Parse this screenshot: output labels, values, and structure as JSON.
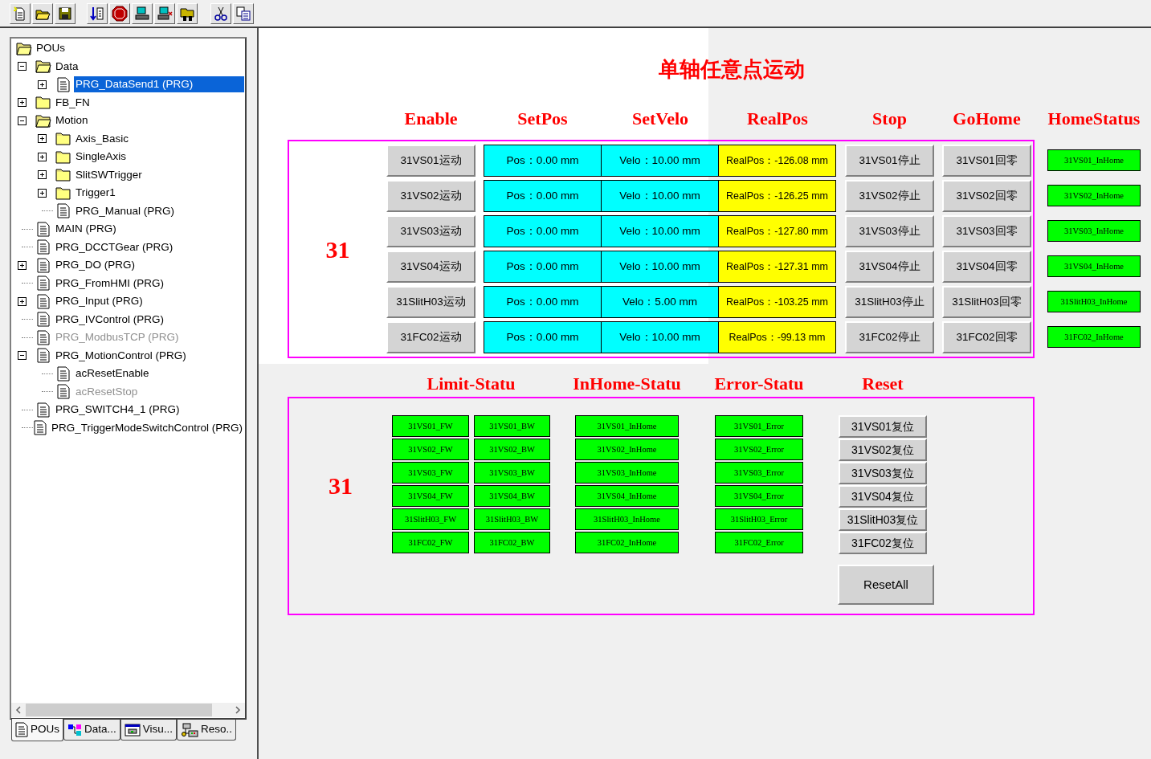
{
  "tree": {
    "label": "POUs",
    "kind": "root",
    "selected": false,
    "disabled": false,
    "children": [
      {
        "label": "Data",
        "kind": "folder",
        "expanded": true,
        "selected": false,
        "disabled": false,
        "children": [
          {
            "label": "PRG_DataSend1 (PRG)",
            "kind": "file",
            "expanded": false,
            "selected": true,
            "disabled": false
          }
        ]
      },
      {
        "label": "FB_FN",
        "kind": "folder",
        "expanded": false,
        "selected": false,
        "disabled": false
      },
      {
        "label": "Motion",
        "kind": "folder",
        "expanded": true,
        "selected": false,
        "disabled": false,
        "children": [
          {
            "label": "Axis_Basic",
            "kind": "folder",
            "expanded": false,
            "selected": false,
            "disabled": false
          },
          {
            "label": "SingleAxis",
            "kind": "folder",
            "expanded": false,
            "selected": false,
            "disabled": false
          },
          {
            "label": "SlitSWTrigger",
            "kind": "folder",
            "expanded": false,
            "selected": false,
            "disabled": false
          },
          {
            "label": "Trigger1",
            "kind": "folder",
            "expanded": false,
            "selected": false,
            "disabled": false
          },
          {
            "label": "PRG_Manual (PRG)",
            "kind": "file",
            "selected": false,
            "disabled": false
          }
        ]
      },
      {
        "label": "MAIN (PRG)",
        "kind": "file",
        "selected": false,
        "disabled": false
      },
      {
        "label": "PRG_DCCTGear (PRG)",
        "kind": "file",
        "selected": false,
        "disabled": false
      },
      {
        "label": "PRG_DO (PRG)",
        "kind": "file",
        "expanded": false,
        "selected": false,
        "disabled": false
      },
      {
        "label": "PRG_FromHMI (PRG)",
        "kind": "file",
        "selected": false,
        "disabled": false
      },
      {
        "label": "PRG_Input (PRG)",
        "kind": "file",
        "expanded": false,
        "selected": false,
        "disabled": false
      },
      {
        "label": "PRG_IVControl (PRG)",
        "kind": "file",
        "selected": false,
        "disabled": false
      },
      {
        "label": "PRG_ModbusTCP (PRG)",
        "kind": "file",
        "selected": false,
        "disabled": true
      },
      {
        "label": "PRG_MotionControl (PRG)",
        "kind": "file",
        "expanded": true,
        "selected": false,
        "disabled": false,
        "children": [
          {
            "label": "acResetEnable",
            "kind": "file",
            "selected": false,
            "disabled": false
          },
          {
            "label": "acResetStop",
            "kind": "file",
            "selected": false,
            "disabled": true
          }
        ]
      },
      {
        "label": "PRG_SWITCH4_1 (PRG)",
        "kind": "file",
        "selected": false,
        "disabled": false
      },
      {
        "label": "PRG_TriggerModeSwitchControl (PRG)",
        "kind": "file",
        "selected": false,
        "disabled": false
      }
    ]
  },
  "panel_tabs": [
    {
      "label": "POUs",
      "selected": true
    },
    {
      "label": "Data...",
      "selected": false
    },
    {
      "label": "Visu...",
      "selected": false
    },
    {
      "label": "Reso..",
      "selected": false
    }
  ],
  "visualization": {
    "title": "单轴任意点运动",
    "motion": {
      "columns": [
        "Enable",
        "SetPos",
        "SetVelo",
        "RealPos",
        "Stop",
        "GoHome",
        "HomeStatus"
      ],
      "group": "31",
      "rows": [
        {
          "enable": "31VS01运动",
          "set_pos": "Pos：0.00 mm",
          "set_velo": "Velo：10.00 mm",
          "real_pos": "RealPos：-126.08 mm",
          "stop": "31VS01停止",
          "go_home": "31VS01回零",
          "home_status": "31VS01_InHome"
        },
        {
          "enable": "31VS02运动",
          "set_pos": "Pos：0.00 mm",
          "set_velo": "Velo：10.00 mm",
          "real_pos": "RealPos：-126.25 mm",
          "stop": "31VS02停止",
          "go_home": "31VS02回零",
          "home_status": "31VS02_InHome"
        },
        {
          "enable": "31VS03运动",
          "set_pos": "Pos：0.00 mm",
          "set_velo": "Velo：10.00 mm",
          "real_pos": "RealPos：-127.80 mm",
          "stop": "31VS03停止",
          "go_home": "31VS03回零",
          "home_status": "31VS03_InHome"
        },
        {
          "enable": "31VS04运动",
          "set_pos": "Pos：0.00 mm",
          "set_velo": "Velo：10.00 mm",
          "real_pos": "RealPos：-127.31 mm",
          "stop": "31VS04停止",
          "go_home": "31VS04回零",
          "home_status": "31VS04_InHome"
        },
        {
          "enable": "31SlitH03运动",
          "set_pos": "Pos：0.00 mm",
          "set_velo": "Velo：5.00 mm",
          "real_pos": "RealPos：-103.25 mm",
          "stop": "31SlitH03停止",
          "go_home": "31SlitH03回零",
          "home_status": "31SlitH03_InHome"
        },
        {
          "enable": "31FC02运动",
          "set_pos": "Pos：0.00 mm",
          "set_velo": "Velo：10.00 mm",
          "real_pos": "RealPos：-99.13 mm",
          "stop": "31FC02停止",
          "go_home": "31FC02回零",
          "home_status": "31FC02_InHome"
        }
      ]
    },
    "status": {
      "columns": [
        "Limit-Statu",
        "InHome-Statu",
        "Error-Statu",
        "Reset"
      ],
      "group": "31",
      "rows": [
        {
          "fw": "31VS01_FW",
          "bw": "31VS01_BW",
          "in_home": "31VS01_InHome",
          "error": "31VS01_Error",
          "reset": "31VS01复位"
        },
        {
          "fw": "31VS02_FW",
          "bw": "31VS02_BW",
          "in_home": "31VS02_InHome",
          "error": "31VS02_Error",
          "reset": "31VS02复位"
        },
        {
          "fw": "31VS03_FW",
          "bw": "31VS03_BW",
          "in_home": "31VS03_InHome",
          "error": "31VS03_Error",
          "reset": "31VS03复位"
        },
        {
          "fw": "31VS04_FW",
          "bw": "31VS04_BW",
          "in_home": "31VS04_InHome",
          "error": "31VS04_Error",
          "reset": "31VS04复位"
        },
        {
          "fw": "31SlitH03_FW",
          "bw": "31SlitH03_BW",
          "in_home": "31SlitH03_InHome",
          "error": "31SlitH03_Error",
          "reset": "31SlitH03复位"
        },
        {
          "fw": "31FC02_FW",
          "bw": "31FC02_BW",
          "in_home": "31FC02_InHome",
          "error": "31FC02_Error",
          "reset": "31FC02复位"
        }
      ],
      "reset_all": "ResetAll"
    }
  }
}
